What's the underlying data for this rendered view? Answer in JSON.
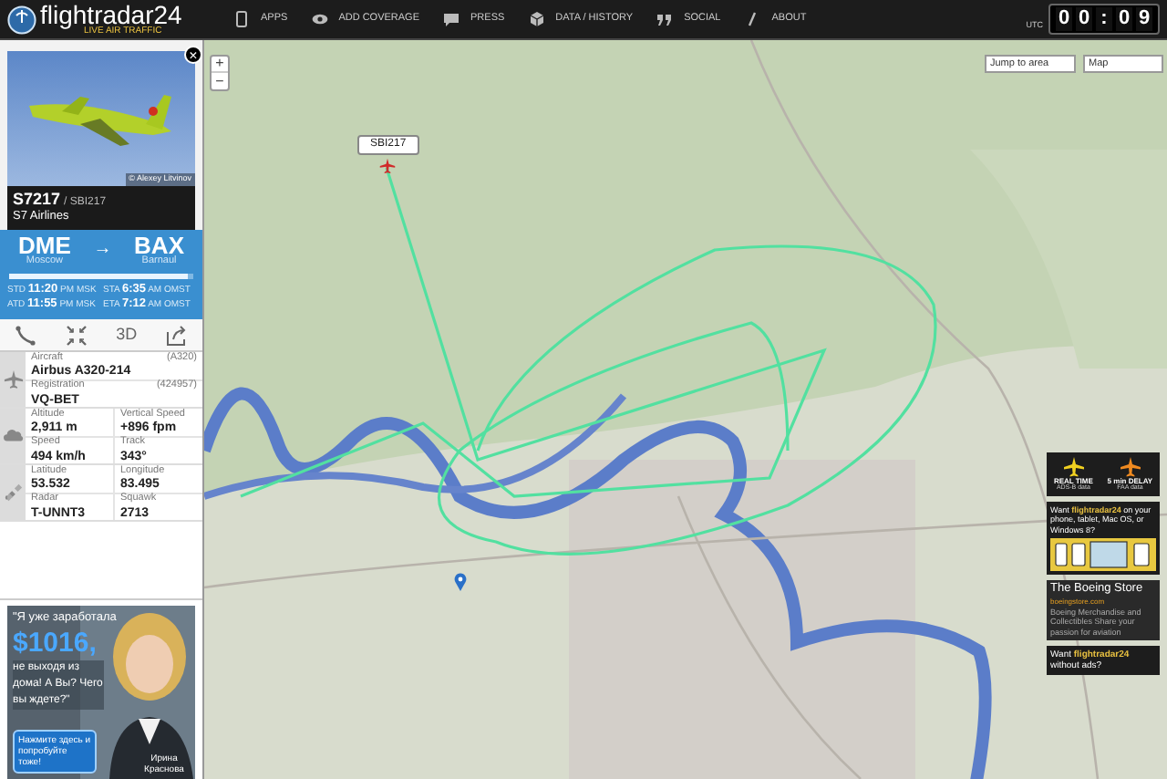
{
  "header": {
    "logo": "flightradar24",
    "tagline": "LIVE AIR TRAFFIC",
    "nav": [
      {
        "label": "APPS"
      },
      {
        "label": "ADD COVERAGE"
      },
      {
        "label": "PRESS"
      },
      {
        "label": "DATA / HISTORY"
      },
      {
        "label": "SOCIAL"
      },
      {
        "label": "ABOUT"
      }
    ],
    "clock": {
      "zone": "UTC",
      "digits": [
        "0",
        "0",
        ":",
        "0",
        "9"
      ]
    }
  },
  "map": {
    "zoom_in": "+",
    "zoom_out": "−",
    "jump": "Jump to area",
    "type": "Map",
    "flight_label": "SBI217"
  },
  "flight": {
    "close": "×",
    "photo_credit": "© Alexey Litvinov",
    "flight": "S7217",
    "callsign": "/ SBI217",
    "airline": "S7 Airlines",
    "from": {
      "code": "DME",
      "city": "Moscow"
    },
    "arrow": "→",
    "to": {
      "code": "BAX",
      "city": "Barnaul"
    },
    "progress": {
      "level": 0.97
    },
    "times": [
      {
        "label": "STD",
        "time": "11:20",
        "suffix": "PM MSK"
      },
      {
        "label": "STA",
        "time": "6:35",
        "suffix": "AM OMST"
      },
      {
        "label": "ATD",
        "time": "11:55",
        "suffix": "PM MSK"
      },
      {
        "label": "ETA",
        "time": "7:12",
        "suffix": "AM OMST"
      }
    ],
    "tools": [
      {
        "kind": "icon"
      },
      {
        "kind": "icon"
      },
      {
        "kind": "text",
        "label": "3D"
      },
      {
        "kind": "icon"
      }
    ],
    "sections": [
      {
        "rows": [
          [
            {
              "label": "Aircraft",
              "value": "Airbus A320-214",
              "note": "(A320)"
            }
          ],
          [
            {
              "label": "Registration",
              "value": "VQ-BET",
              "note": "(424957)"
            }
          ]
        ]
      },
      {
        "rows": [
          [
            {
              "label": "Altitude",
              "value": "2,911 m"
            },
            {
              "label": "Vertical Speed",
              "value": "+896 fpm"
            }
          ],
          [
            {
              "label": "Speed",
              "value": "494 km/h"
            },
            {
              "label": "Track",
              "value": "343°"
            }
          ]
        ]
      },
      {
        "rows": [
          [
            {
              "label": "Latitude",
              "value": "53.532"
            },
            {
              "label": "Longitude",
              "value": "83.495"
            }
          ],
          [
            {
              "label": "Radar",
              "value": "T-UNNT3"
            },
            {
              "label": "Squawk",
              "value": "2713"
            }
          ]
        ]
      }
    ]
  },
  "ads": {
    "left": {
      "quote": "\"Я уже заработала",
      "amount": "$1016,",
      "body": "не выходя из дома! А Вы? Чего вы ждете?\"",
      "cta": "Нажмите здесь и попробуйте тоже!",
      "person": "Ирина Краснова"
    },
    "right": {
      "feeds": [
        {
          "title": "REAL TIME",
          "sub": "ADS-B data",
          "color": "#f0d020"
        },
        {
          "title": "5 min DELAY",
          "sub": "FAA data",
          "color": "#f08a20"
        }
      ],
      "apps": "Want **flightradar24** on your phone, tablet, Mac OS, or Windows 8?",
      "store": {
        "title": "The Boeing Store",
        "url": "boeingstore.com",
        "text": "Boeing Merchandise and Collectibles Share your passion for aviation"
      },
      "noads": "Want **flightradar24** without ads?"
    }
  }
}
